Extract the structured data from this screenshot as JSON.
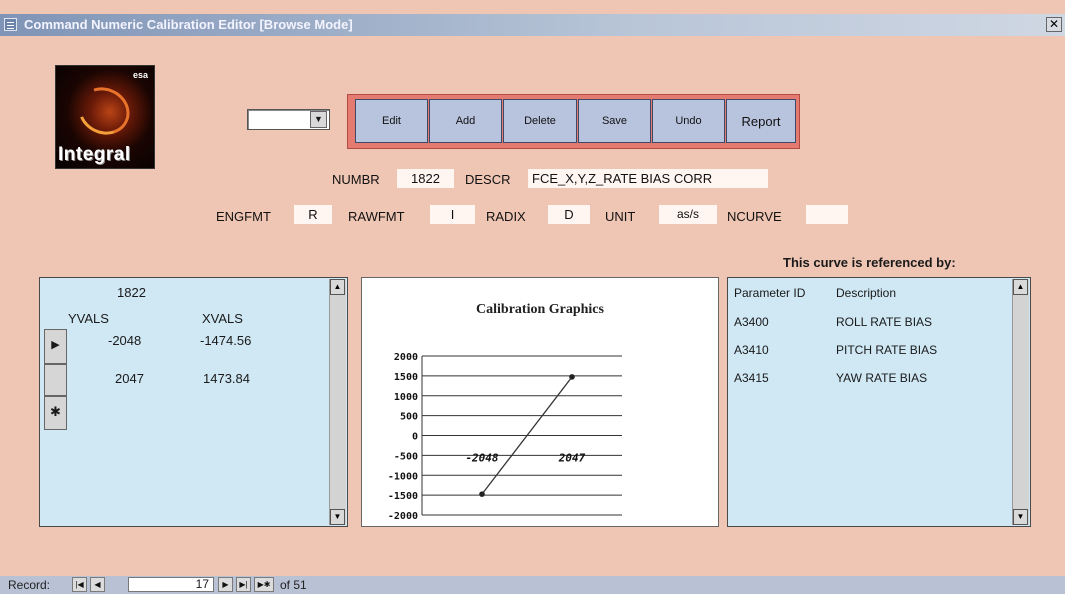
{
  "window": {
    "title": "Command Numeric Calibration Editor [Browse Mode]",
    "close_glyph": "✕"
  },
  "logo": {
    "text": "Integral",
    "badge": "esa"
  },
  "combo": {
    "value": "",
    "arrow": "▼"
  },
  "toolbar": {
    "buttons": [
      "Edit",
      "Add",
      "Delete",
      "Save",
      "Undo",
      "Report"
    ]
  },
  "fields": {
    "numbr_label": "NUMBR",
    "numbr": "1822",
    "descr_label": "DESCR",
    "descr": "FCE_X,Y,Z_RATE BIAS CORR",
    "engfmt_label": "ENGFMT",
    "engfmt": "R",
    "rawfmt_label": "RAWFMT",
    "rawfmt": "I",
    "radix_label": "RADIX",
    "radix": "D",
    "unit_label": "UNIT",
    "unit": "as/s",
    "ncurve_label": "NCURVE",
    "ncurve": ""
  },
  "values_panel": {
    "id": "1822",
    "col_y": "YVALS",
    "col_x": "XVALS",
    "rows": [
      {
        "y": "-2048",
        "x": "-1474.56"
      },
      {
        "y": "2047",
        "x": "1473.84"
      }
    ],
    "current_marker": "▶",
    "new_marker": "✱"
  },
  "chart_data": {
    "type": "line",
    "title": "Calibration Graphics",
    "x": [
      -2048,
      2047
    ],
    "y": [
      -1474.56,
      1473.84
    ],
    "x_tick_labels": [
      "-2048",
      "2047"
    ],
    "y_ticks": [
      "2000",
      "1500",
      "1000",
      "500",
      "0",
      "-500",
      "-1000",
      "-1500",
      "-2000"
    ],
    "ylim": [
      -2000,
      2000
    ],
    "xlim": [
      -2048,
      2047
    ],
    "line_color": "#333333"
  },
  "ref_panel": {
    "heading": "This curve is referenced by:",
    "col_param": "Parameter ID",
    "col_desc": "Description",
    "rows": [
      {
        "id": "A3400",
        "desc": "ROLL RATE BIAS"
      },
      {
        "id": "A3410",
        "desc": "PITCH RATE BIAS"
      },
      {
        "id": "A3415",
        "desc": "YAW RATE BIAS"
      }
    ]
  },
  "scroll": {
    "up": "▲",
    "down": "▼"
  },
  "record_nav": {
    "label": "Record:",
    "first": "|◀",
    "prev": "◀",
    "current": "17",
    "next": "▶",
    "last": "▶|",
    "new": "▶✱",
    "of_text": "of 51"
  }
}
